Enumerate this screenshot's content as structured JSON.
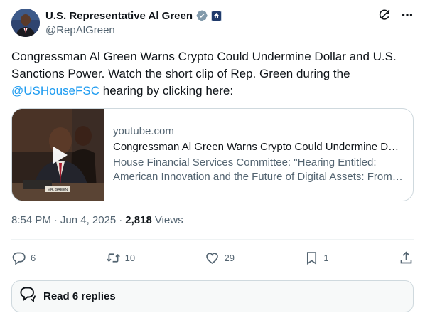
{
  "author": {
    "name": "U.S. Representative Al Green",
    "handle": "@RepAlGreen"
  },
  "tweet": {
    "text_before": "Congressman Al Green Warns Crypto Could Undermine Dollar and U.S. Sanctions Power. Watch the short clip of Rep. Green during the ",
    "mention": "@USHouseFSC",
    "text_after": " hearing by clicking here:"
  },
  "card": {
    "domain": "youtube.com",
    "title": "Congressman Al Green Warns Crypto Could Undermine Dollar and U.S. Sanctions Power",
    "description": "House Financial Services Committee: \"Hearing Entitled: American Innovation and the Future of Digital Assets: From Blueprint to a Functional Framework\"",
    "nameplate": "MR. GREEN"
  },
  "meta": {
    "time": "8:54 PM",
    "separator": "·",
    "date": "Jun 4, 2025",
    "views_count": "2,818",
    "views_label": "Views"
  },
  "actions": {
    "replies": "6",
    "reposts": "10",
    "likes": "29",
    "bookmarks": "1"
  },
  "replies_button": {
    "label": "Read 6 replies"
  },
  "colors": {
    "link": "#1d9bf0",
    "muted": "#536471",
    "verified": "#829aab"
  }
}
